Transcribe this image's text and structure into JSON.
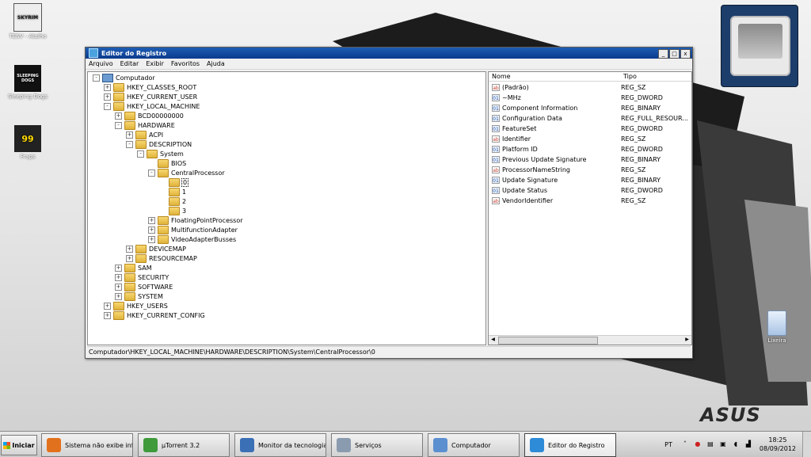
{
  "desktop": {
    "icons": [
      {
        "label": "TESV - Atalho",
        "art": "SKYRIM"
      },
      {
        "label": "Sleeping Dogs",
        "art": "SLEEPING DOGS"
      },
      {
        "label": "Fraps",
        "art": "99"
      }
    ],
    "recycle_bin_label": "Lixeira",
    "brand_logo": "ASUS"
  },
  "window": {
    "title": "Editor do Registro",
    "buttons": [
      "_",
      "□",
      "x"
    ],
    "menu": [
      "Arquivo",
      "Editar",
      "Exibir",
      "Favoritos",
      "Ajuda"
    ],
    "statusbar": "Computador\\HKEY_LOCAL_MACHINE\\HARDWARE\\DESCRIPTION\\System\\CentralProcessor\\0"
  },
  "tree": [
    {
      "label": "Computador",
      "level": 0,
      "toggle": "-",
      "kind": "pc"
    },
    {
      "label": "HKEY_CLASSES_ROOT",
      "level": 1,
      "toggle": "+"
    },
    {
      "label": "HKEY_CURRENT_USER",
      "level": 1,
      "toggle": "+"
    },
    {
      "label": "HKEY_LOCAL_MACHINE",
      "level": 1,
      "toggle": "-"
    },
    {
      "label": "BCD00000000",
      "level": 2,
      "toggle": "+"
    },
    {
      "label": "HARDWARE",
      "level": 2,
      "toggle": "-"
    },
    {
      "label": "ACPI",
      "level": 3,
      "toggle": "+"
    },
    {
      "label": "DESCRIPTION",
      "level": 3,
      "toggle": "-"
    },
    {
      "label": "System",
      "level": 4,
      "toggle": "-"
    },
    {
      "label": "BIOS",
      "level": 5,
      "toggle": ""
    },
    {
      "label": "CentralProcessor",
      "level": 5,
      "toggle": "-"
    },
    {
      "label": "0",
      "level": 6,
      "toggle": "",
      "selected": true
    },
    {
      "label": "1",
      "level": 6,
      "toggle": ""
    },
    {
      "label": "2",
      "level": 6,
      "toggle": ""
    },
    {
      "label": "3",
      "level": 6,
      "toggle": ""
    },
    {
      "label": "FloatingPointProcessor",
      "level": 5,
      "toggle": "+"
    },
    {
      "label": "MultifunctionAdapter",
      "level": 5,
      "toggle": "+"
    },
    {
      "label": "VideoAdapterBusses",
      "level": 5,
      "toggle": "+"
    },
    {
      "label": "DEVICEMAP",
      "level": 3,
      "toggle": "+"
    },
    {
      "label": "RESOURCEMAP",
      "level": 3,
      "toggle": "+"
    },
    {
      "label": "SAM",
      "level": 2,
      "toggle": "+"
    },
    {
      "label": "SECURITY",
      "level": 2,
      "toggle": "+"
    },
    {
      "label": "SOFTWARE",
      "level": 2,
      "toggle": "+"
    },
    {
      "label": "SYSTEM",
      "level": 2,
      "toggle": "+"
    },
    {
      "label": "HKEY_USERS",
      "level": 1,
      "toggle": "+"
    },
    {
      "label": "HKEY_CURRENT_CONFIG",
      "level": 1,
      "toggle": "+"
    }
  ],
  "values": {
    "columns": [
      "Nome",
      "Tipo"
    ],
    "rows": [
      {
        "name": "(Padrão)",
        "type": "REG_SZ",
        "icon": "ab"
      },
      {
        "name": "~MHz",
        "type": "REG_DWORD",
        "icon": "num"
      },
      {
        "name": "Component Information",
        "type": "REG_BINARY",
        "icon": "num"
      },
      {
        "name": "Configuration Data",
        "type": "REG_FULL_RESOUR...",
        "icon": "num"
      },
      {
        "name": "FeatureSet",
        "type": "REG_DWORD",
        "icon": "num"
      },
      {
        "name": "Identifier",
        "type": "REG_SZ",
        "icon": "ab"
      },
      {
        "name": "Platform ID",
        "type": "REG_DWORD",
        "icon": "num"
      },
      {
        "name": "Previous Update Signature",
        "type": "REG_BINARY",
        "icon": "num"
      },
      {
        "name": "ProcessorNameString",
        "type": "REG_SZ",
        "icon": "ab"
      },
      {
        "name": "Update Signature",
        "type": "REG_BINARY",
        "icon": "num"
      },
      {
        "name": "Update Status",
        "type": "REG_DWORD",
        "icon": "num"
      },
      {
        "name": "VendorIdentifier",
        "type": "REG_SZ",
        "icon": "ab"
      }
    ]
  },
  "taskbar": {
    "start_label": "Iniciar",
    "buttons": [
      {
        "label": "Sistema não exibe inf...",
        "color": "#e2711d"
      },
      {
        "label": "µTorrent 3.2",
        "color": "#3f9a3a"
      },
      {
        "label": "Monitor da tecnologia...",
        "color": "#3b6fb6"
      },
      {
        "label": "Serviços",
        "color": "#8a9bb0"
      },
      {
        "label": "Computador",
        "color": "#5b8fd0"
      },
      {
        "label": "Editor do Registro",
        "color": "#2e8bd8",
        "active": true
      }
    ],
    "language": "PT",
    "time": "18:25",
    "date": "08/09/2012"
  }
}
